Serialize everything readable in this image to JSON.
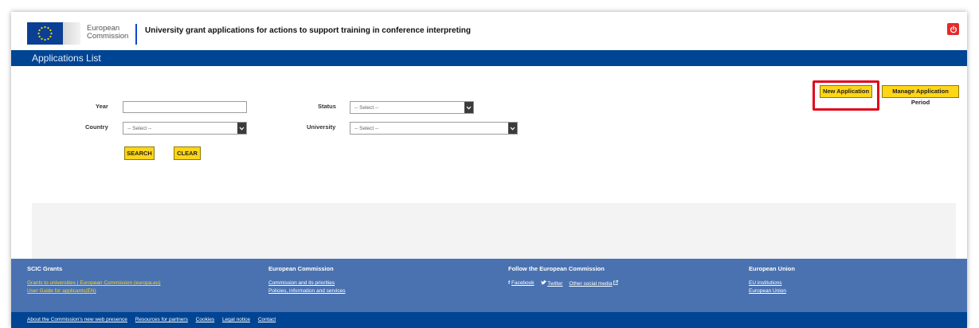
{
  "header": {
    "logo_line1": "European",
    "logo_line2": "Commission",
    "title": "University grant applications for actions to support training in conference interpreting",
    "logout_icon": "power-icon"
  },
  "page_bar": {
    "title": "Applications List"
  },
  "actions": {
    "new_application": "New Application",
    "manage_period": "Manage Application Period"
  },
  "filters": {
    "year_label": "Year",
    "year_value": "",
    "status_label": "Status",
    "status_value": "-- Select --",
    "country_label": "Country",
    "country_value": "-- Select --",
    "university_label": "University",
    "university_value": "-- Select --",
    "search": "SEARCH",
    "clear": "CLEAR"
  },
  "footer": {
    "col1": {
      "title": "SCIC Grants",
      "links": [
        "Grants to universities | European Commission (europa.eu)",
        "User Guide for applicants(EN)"
      ]
    },
    "col2": {
      "title": "European Commission",
      "links": [
        "Commission and its priorities",
        "Policies, information and services"
      ]
    },
    "col3": {
      "title": "Follow the European Commission",
      "facebook": "Facebook",
      "twitter": "Twitter",
      "other": "Other social media"
    },
    "col4": {
      "title": "European Union",
      "links": [
        "EU institutions",
        "European Union"
      ]
    },
    "bottom_links": [
      "About the Commission's new web presence",
      "Resources for partners",
      "Cookies",
      "Legal notice",
      "Contact"
    ]
  },
  "colors": {
    "brand_blue": "#004494",
    "footer_blue": "#4a72b1",
    "accent_yellow": "#ffd617",
    "highlight_red": "#e0071a"
  }
}
